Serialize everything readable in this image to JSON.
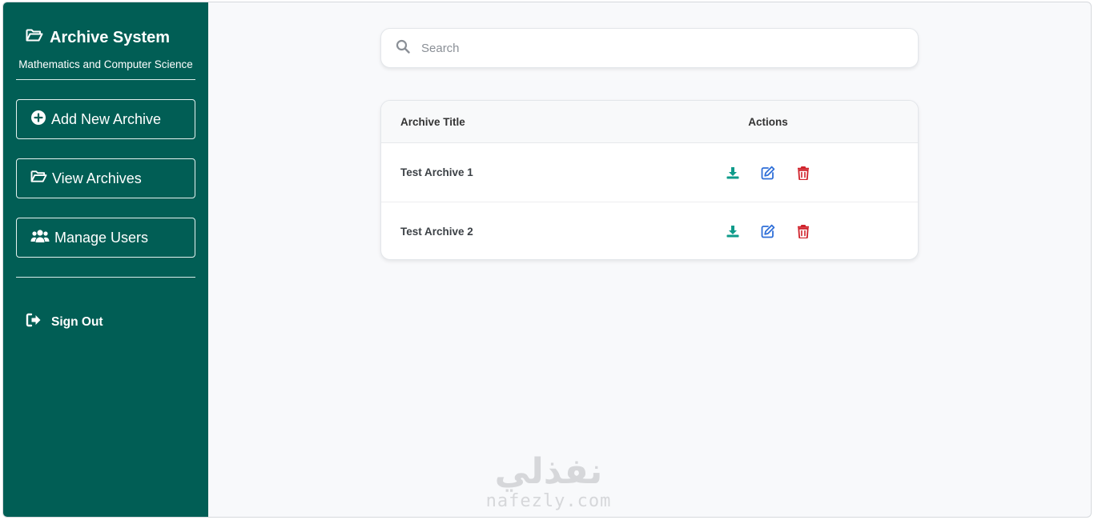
{
  "sidebar": {
    "brand_title": "Archive System",
    "brand_subtitle": "Mathematics and Computer Science",
    "nav": [
      {
        "label": "Add New Archive",
        "icon": "plus-circle-icon"
      },
      {
        "label": "View Archives",
        "icon": "folder-open-icon"
      },
      {
        "label": "Manage Users",
        "icon": "users-icon"
      }
    ],
    "signout_label": "Sign Out"
  },
  "search": {
    "placeholder": "Search",
    "value": ""
  },
  "table": {
    "headers": {
      "title": "Archive Title",
      "actions": "Actions"
    },
    "rows": [
      {
        "title": "Test Archive 1"
      },
      {
        "title": "Test Archive 2"
      }
    ]
  },
  "watermark": {
    "arabic": "نفذلي",
    "latin": "nafezly.com"
  },
  "colors": {
    "sidebar_bg": "#015e55",
    "download": "#0e9b8a",
    "edit": "#2f6fd8",
    "delete": "#d0222b"
  }
}
